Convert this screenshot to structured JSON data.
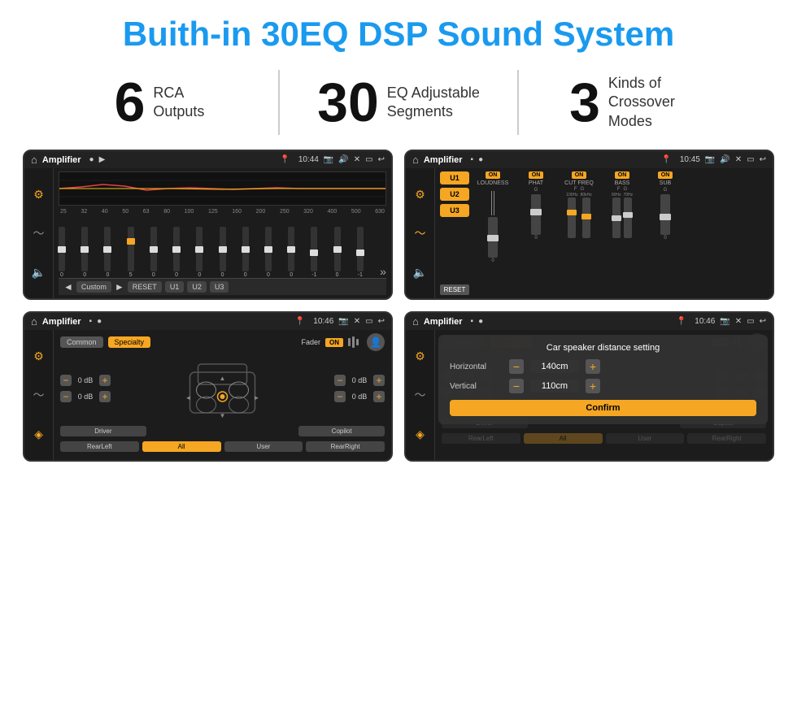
{
  "header": {
    "title": "Buith-in 30EQ DSP Sound System"
  },
  "stats": [
    {
      "number": "6",
      "label_line1": "RCA",
      "label_line2": "Outputs"
    },
    {
      "number": "30",
      "label_line1": "EQ Adjustable",
      "label_line2": "Segments"
    },
    {
      "number": "3",
      "label_line1": "Kinds of",
      "label_line2": "Crossover Modes"
    }
  ],
  "screens": [
    {
      "id": "eq-screen",
      "title": "Amplifier",
      "time": "10:44",
      "freq_labels": [
        "25",
        "32",
        "40",
        "50",
        "63",
        "80",
        "100",
        "125",
        "160",
        "200",
        "250",
        "320",
        "400",
        "500",
        "630"
      ],
      "slider_values": [
        "0",
        "0",
        "0",
        "5",
        "0",
        "0",
        "0",
        "0",
        "0",
        "0",
        "0",
        "-1",
        "0",
        "-1"
      ],
      "bottom_buttons": [
        "Custom",
        "RESET",
        "U1",
        "U2",
        "U3"
      ]
    },
    {
      "id": "crossover-screen",
      "title": "Amplifier",
      "time": "10:45",
      "u_buttons": [
        "U1",
        "U2",
        "U3"
      ],
      "channels": [
        "LOUDNESS",
        "PHAT",
        "CUT FREQ",
        "BASS",
        "SUB"
      ]
    },
    {
      "id": "fader-screen",
      "title": "Amplifier",
      "time": "10:46",
      "tabs": [
        "Common",
        "Specialty"
      ],
      "fader_label": "Fader",
      "vol_controls": [
        "0 dB",
        "0 dB",
        "0 dB",
        "0 dB"
      ],
      "bottom_buttons": [
        "Driver",
        "",
        "All",
        "",
        "User",
        "RearRight"
      ],
      "left_btn": "Driver",
      "right_btn": "Copilot",
      "bottom_left": "RearLeft",
      "bottom_all": "All",
      "bottom_user": "User",
      "bottom_right": "RearRight"
    },
    {
      "id": "distance-screen",
      "title": "Amplifier",
      "time": "10:46",
      "overlay_title": "Car speaker distance setting",
      "horizontal_label": "Horizontal",
      "horizontal_value": "140cm",
      "vertical_label": "Vertical",
      "vertical_value": "110cm",
      "confirm_label": "Confirm",
      "tabs": [
        "Common",
        "Specialty"
      ],
      "bottom_left": "RearLeft",
      "bottom_all": "All",
      "bottom_user": "User",
      "bottom_right": "RearRight"
    }
  ]
}
